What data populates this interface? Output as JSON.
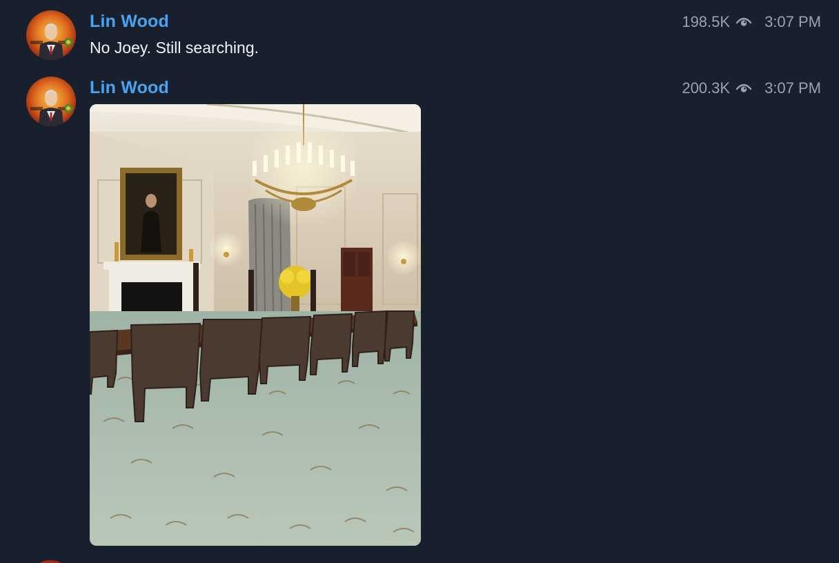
{
  "messages": [
    {
      "author": "Lin Wood",
      "text": "No Joey. Still searching.",
      "views": "198.5K",
      "time": "3:07 PM",
      "avatar_icon": "profile-avatar"
    },
    {
      "author": "Lin Wood",
      "views": "200.3K",
      "time": "3:07 PM",
      "avatar_icon": "profile-avatar",
      "attachment": {
        "type": "photo",
        "subject": "formal dining room with chandelier, long table and chairs"
      }
    }
  ],
  "colors": {
    "background": "#18202d",
    "author_name": "#4aa3f0",
    "message_text": "#f2f4f7",
    "meta_text": "#9aa3ae"
  },
  "icons": {
    "views": "eye-icon"
  }
}
